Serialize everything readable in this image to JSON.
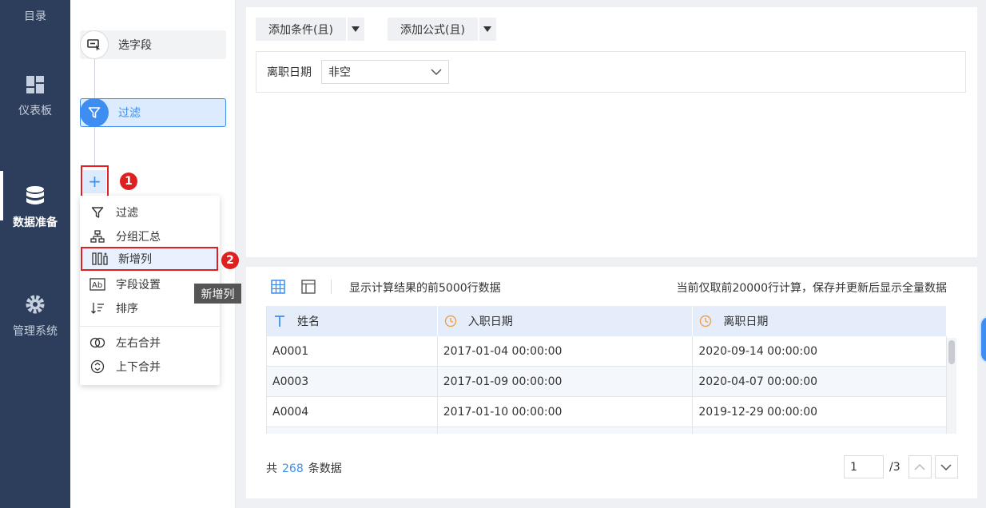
{
  "nav": {
    "items": [
      {
        "label": "目录",
        "icon": "catalog-icon"
      },
      {
        "label": "仪表板",
        "icon": "dashboard-icon"
      },
      {
        "label": "数据准备",
        "icon": "database-icon",
        "active": true
      },
      {
        "label": "管理系统",
        "icon": "gear-icon"
      }
    ]
  },
  "flow": {
    "steps": [
      {
        "label": "选字段",
        "icon": "select-field-icon"
      },
      {
        "label": "过滤",
        "icon": "filter-icon",
        "active": true
      }
    ],
    "add_label": "+",
    "badge1": "1",
    "badge2": "2",
    "menu": [
      {
        "label": "过滤",
        "icon": "filter-icon"
      },
      {
        "label": "分组汇总",
        "icon": "group-summary-icon"
      },
      {
        "label": "新增列",
        "icon": "new-column-icon",
        "highlighted": true
      },
      {
        "label": "字段设置",
        "icon": "field-settings-icon"
      },
      {
        "label": "排序",
        "icon": "sort-icon"
      },
      {
        "label": "左右合并",
        "icon": "merge-horizontal-icon"
      },
      {
        "label": "上下合并",
        "icon": "merge-vertical-icon"
      }
    ],
    "tooltip": "新增列"
  },
  "filter": {
    "add_condition": "添加条件(且)",
    "add_formula": "添加公式(且)",
    "condition_field": "离职日期",
    "condition_value": "非空"
  },
  "preview": {
    "info_left": "显示计算结果的前5000行数据",
    "info_right": "当前仅取前20000行计算，保存并更新后显示全量数据",
    "columns": [
      {
        "label": "姓名",
        "type": "text"
      },
      {
        "label": "入职日期",
        "type": "date"
      },
      {
        "label": "离职日期",
        "type": "date"
      }
    ],
    "rows": [
      [
        "A0001",
        "2017-01-04 00:00:00",
        "2020-09-14 00:00:00"
      ],
      [
        "A0003",
        "2017-01-09 00:00:00",
        "2020-04-07 00:00:00"
      ],
      [
        "A0004",
        "2017-01-10 00:00:00",
        "2019-12-29 00:00:00"
      ],
      [
        "",
        "",
        ""
      ]
    ],
    "count_prefix": "共",
    "count": "268",
    "count_suffix": "条数据",
    "page": "1",
    "page_total": "/3"
  },
  "colors": {
    "accent": "#3d8ef0",
    "nav_bg": "#2c3e5c",
    "highlight": "#e02020"
  }
}
